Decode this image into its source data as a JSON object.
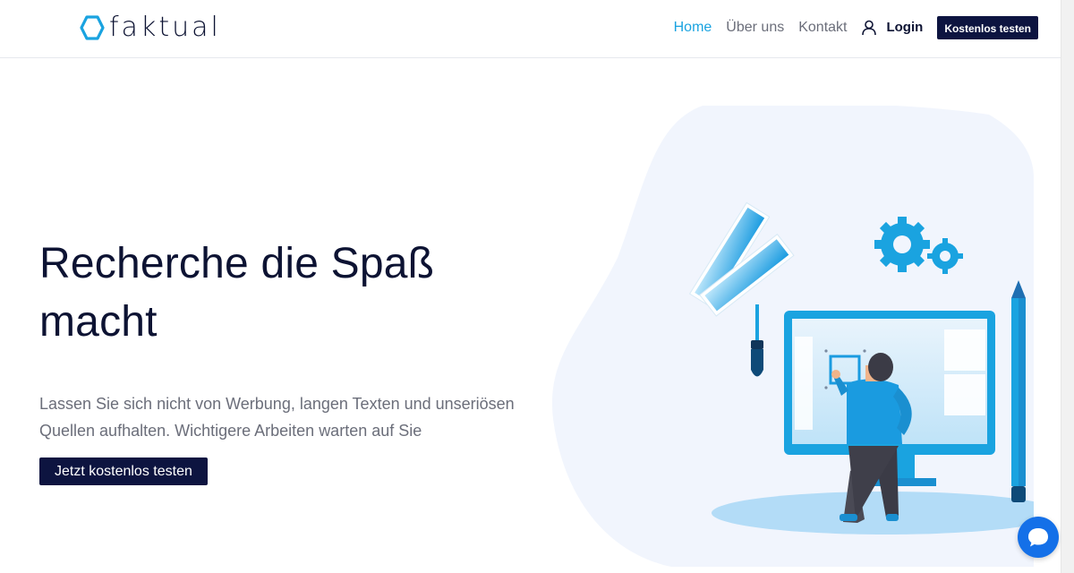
{
  "brand": {
    "name": "faktual"
  },
  "nav": {
    "items": [
      {
        "label": "Home",
        "active": true
      },
      {
        "label": "Über uns",
        "active": false
      },
      {
        "label": "Kontakt",
        "active": false
      }
    ],
    "login_label": "Login",
    "cta_label": "Kostenlos testen"
  },
  "hero": {
    "title": "Recherche die Spaß macht",
    "text": "Lassen Sie sich nicht von Werbung, langen Texten und unseriösen Quellen aufhalten. Wichtigere Arbeiten warten auf Sie",
    "button_label": "Jetzt kostenlos testen"
  },
  "icons": {
    "logo": "hexagon-logo-icon",
    "login": "user-icon",
    "chat": "chat-bubble-icon"
  },
  "colors": {
    "primary_dark": "#0d1440",
    "accent": "#1aa3e0",
    "text_muted": "#6b6e7a",
    "chat": "#1470e8",
    "blob": "#f1f5fd"
  }
}
